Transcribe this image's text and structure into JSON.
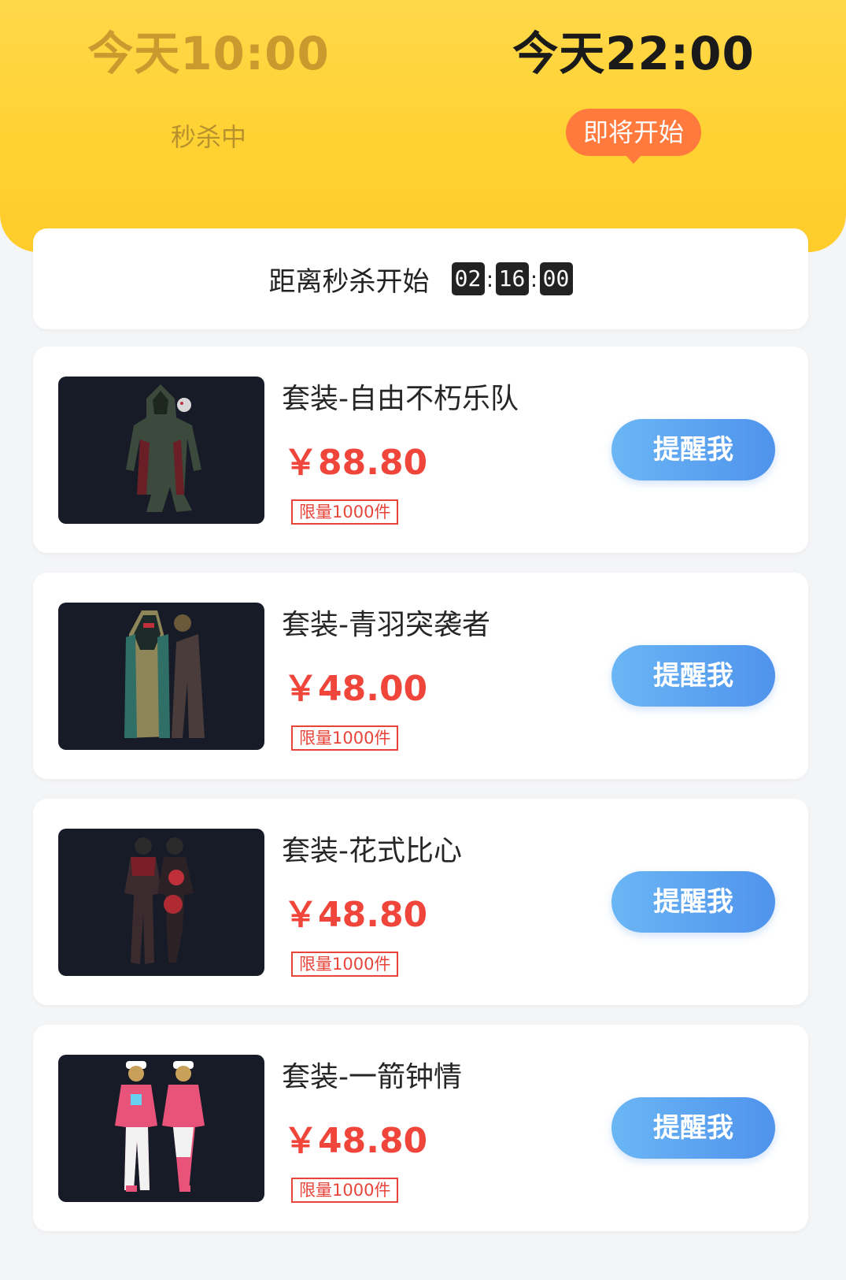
{
  "sessions": [
    {
      "time": "今天10:00",
      "status": "秒杀中"
    },
    {
      "time": "今天22:00",
      "status": "即将开始"
    }
  ],
  "countdown": {
    "label": "距离秒杀开始",
    "hours": "02",
    "minutes": "16",
    "seconds": "00"
  },
  "products": [
    {
      "name": "套装-自由不朽乐队",
      "price": "￥88.80",
      "limit": "限量1000件",
      "button": "提醒我"
    },
    {
      "name": "套装-青羽突袭者",
      "price": "￥48.00",
      "limit": "限量1000件",
      "button": "提醒我"
    },
    {
      "name": "套装-花式比心",
      "price": "￥48.80",
      "limit": "限量1000件",
      "button": "提醒我"
    },
    {
      "name": "套装-一箭钟情",
      "price": "￥48.80",
      "limit": "限量1000件",
      "button": "提醒我"
    }
  ],
  "colors": {
    "header_yellow": "#ffd233",
    "price_red": "#f0453a",
    "button_blue": "#5aa2ef",
    "pill_orange": "#ff7a3c"
  }
}
